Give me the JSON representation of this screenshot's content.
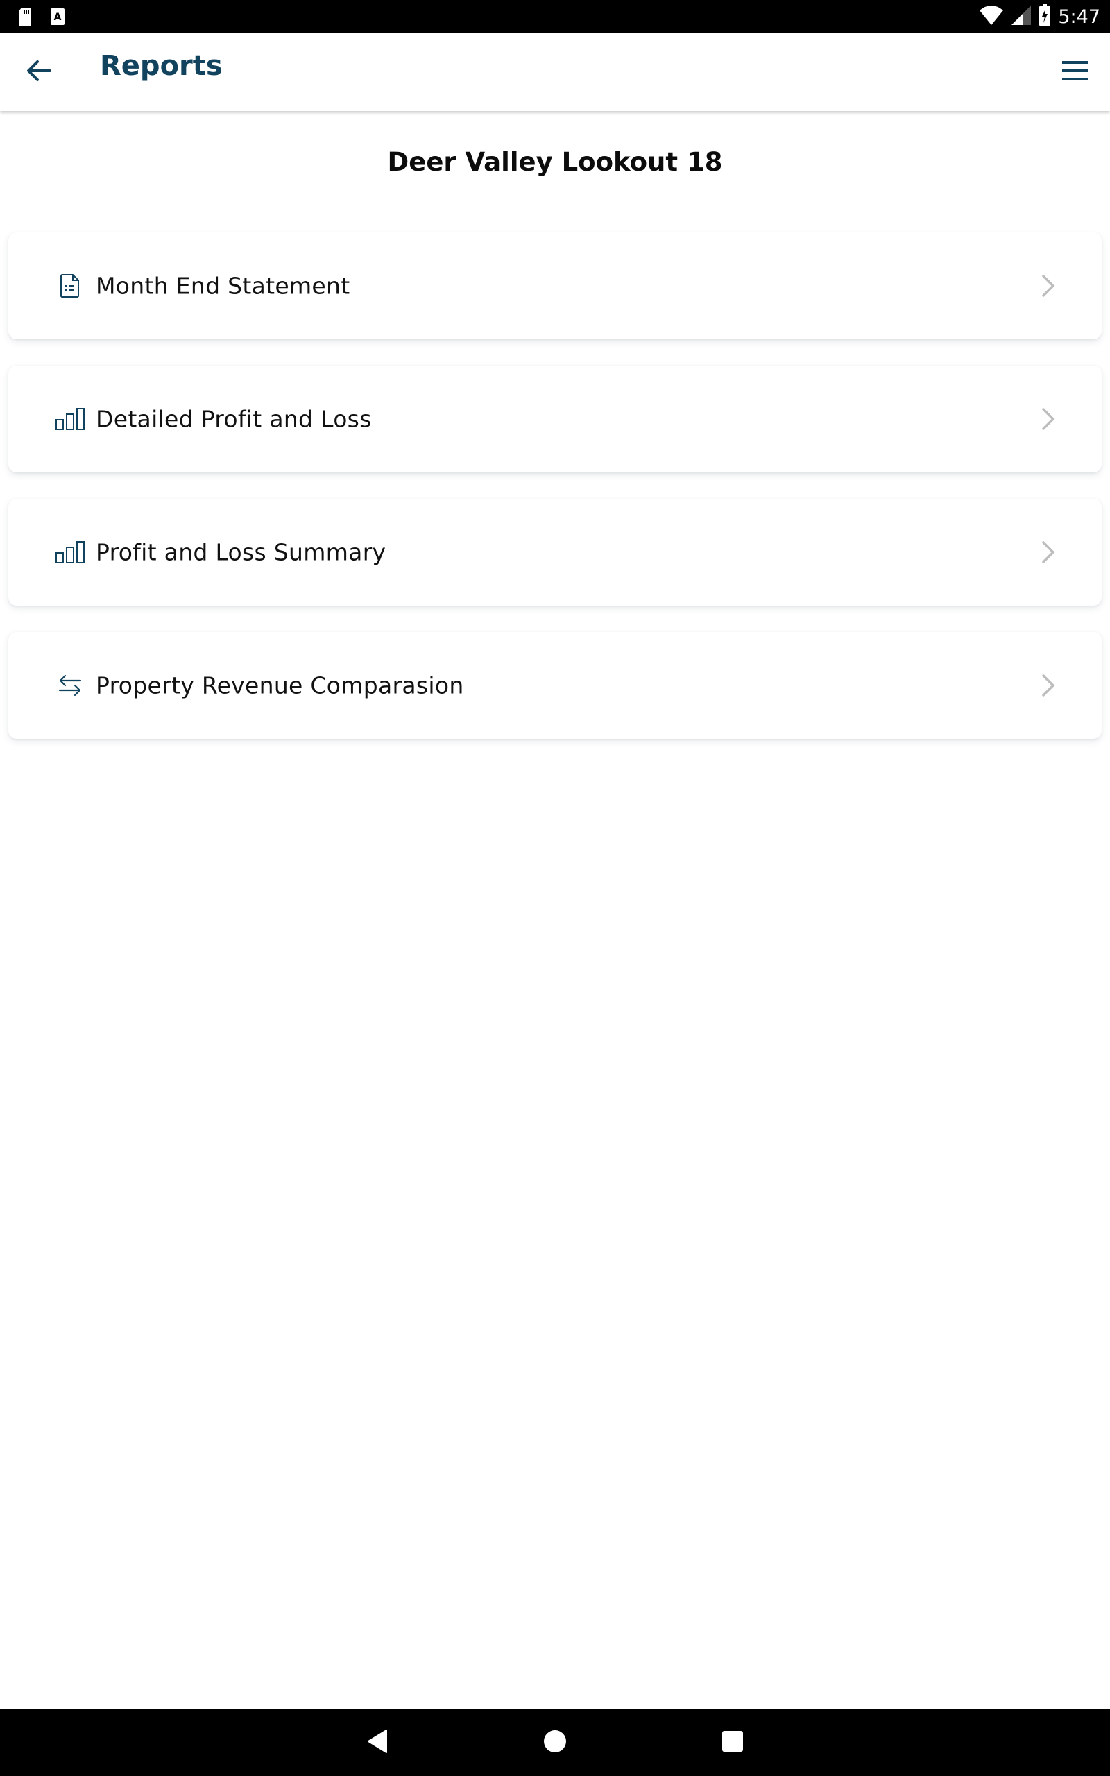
{
  "status_bar": {
    "time": "5:47",
    "left_icons": [
      "sd-card-icon",
      "font-a-icon"
    ],
    "right_icons": [
      "wifi-icon",
      "cell-signal-icon",
      "battery-charging-icon"
    ]
  },
  "app_bar": {
    "title": "Reports",
    "back_icon": "arrow-left-icon",
    "menu_icon": "hamburger-menu-icon"
  },
  "property_title": "Deer Valley Lookout 18",
  "reports": [
    {
      "label": "Month End Statement",
      "icon": "document-list-icon"
    },
    {
      "label": "Detailed Profit and Loss",
      "icon": "bar-chart-icon"
    },
    {
      "label": "Profit and Loss Summary",
      "icon": "bar-chart-icon"
    },
    {
      "label": "Property Revenue Comparasion",
      "icon": "swap-arrows-icon"
    }
  ],
  "colors": {
    "accent": "#12435e",
    "chevron": "#bdbdbd",
    "text": "#111111"
  },
  "nav_bar": {
    "buttons": [
      "back",
      "home",
      "recents"
    ]
  }
}
